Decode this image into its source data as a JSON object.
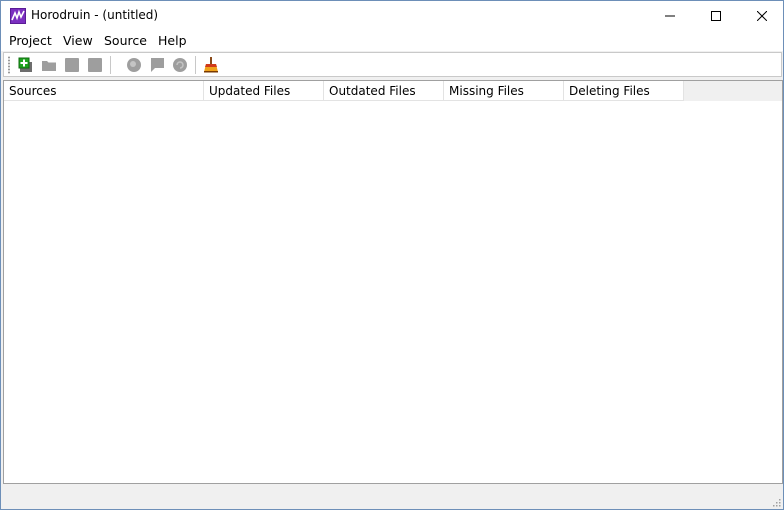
{
  "window": {
    "title": "Horodruin - (untitled)"
  },
  "titlebar": {
    "icon": "horodruin-app-icon",
    "buttons": [
      "minimize-icon",
      "maximize-icon",
      "close-icon"
    ]
  },
  "menubar": {
    "items": [
      "Project",
      "View",
      "Source",
      "Help"
    ]
  },
  "toolbar": {
    "buttons": [
      {
        "name": "add-source-icon",
        "enabled": true
      },
      {
        "name": "open-folder-icon",
        "enabled": false
      },
      {
        "name": "save-icon",
        "enabled": false
      },
      {
        "name": "stop-icon",
        "enabled": false
      },
      {
        "name": "scan-icon",
        "enabled": false
      },
      {
        "name": "comment-icon",
        "enabled": false
      },
      {
        "name": "refresh-icon",
        "enabled": false
      },
      {
        "name": "clean-broom-icon",
        "enabled": true
      }
    ]
  },
  "listview": {
    "columns": [
      "Sources",
      "Updated Files",
      "Outdated Files",
      "Missing Files",
      "Deleting Files"
    ],
    "rows": []
  },
  "statusbar": {
    "text": ""
  },
  "colors": {
    "icon_purple": "#7b2fc0",
    "add_green": "#1fa31f",
    "disabled_gray": "#9e9e9e",
    "broom_red": "#d03a1a",
    "broom_orange": "#f0a21a"
  }
}
